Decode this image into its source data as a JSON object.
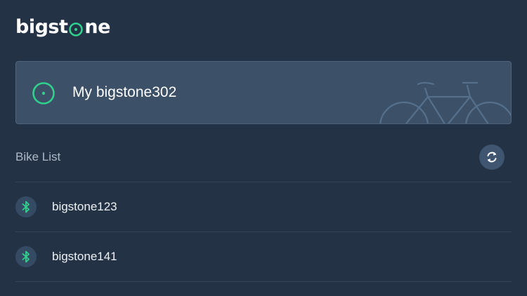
{
  "header": {
    "logo_text_before": "bigst",
    "logo_text_after": "ne",
    "logo_icon": "target-o-icon"
  },
  "current_bike": {
    "title": "My bigstone302",
    "icon": "target-icon",
    "illustration": "bicycle-illustration"
  },
  "bike_list": {
    "title": "Bike List",
    "refresh_icon": "refresh-icon",
    "items": [
      {
        "name": "bigstone123",
        "icon": "bluetooth-icon"
      },
      {
        "name": "bigstone141",
        "icon": "bluetooth-icon"
      }
    ]
  },
  "colors": {
    "background": "#243246",
    "card": "#3c5068",
    "accent_green": "#2fd18d",
    "muted_text": "#aeb9c7"
  }
}
